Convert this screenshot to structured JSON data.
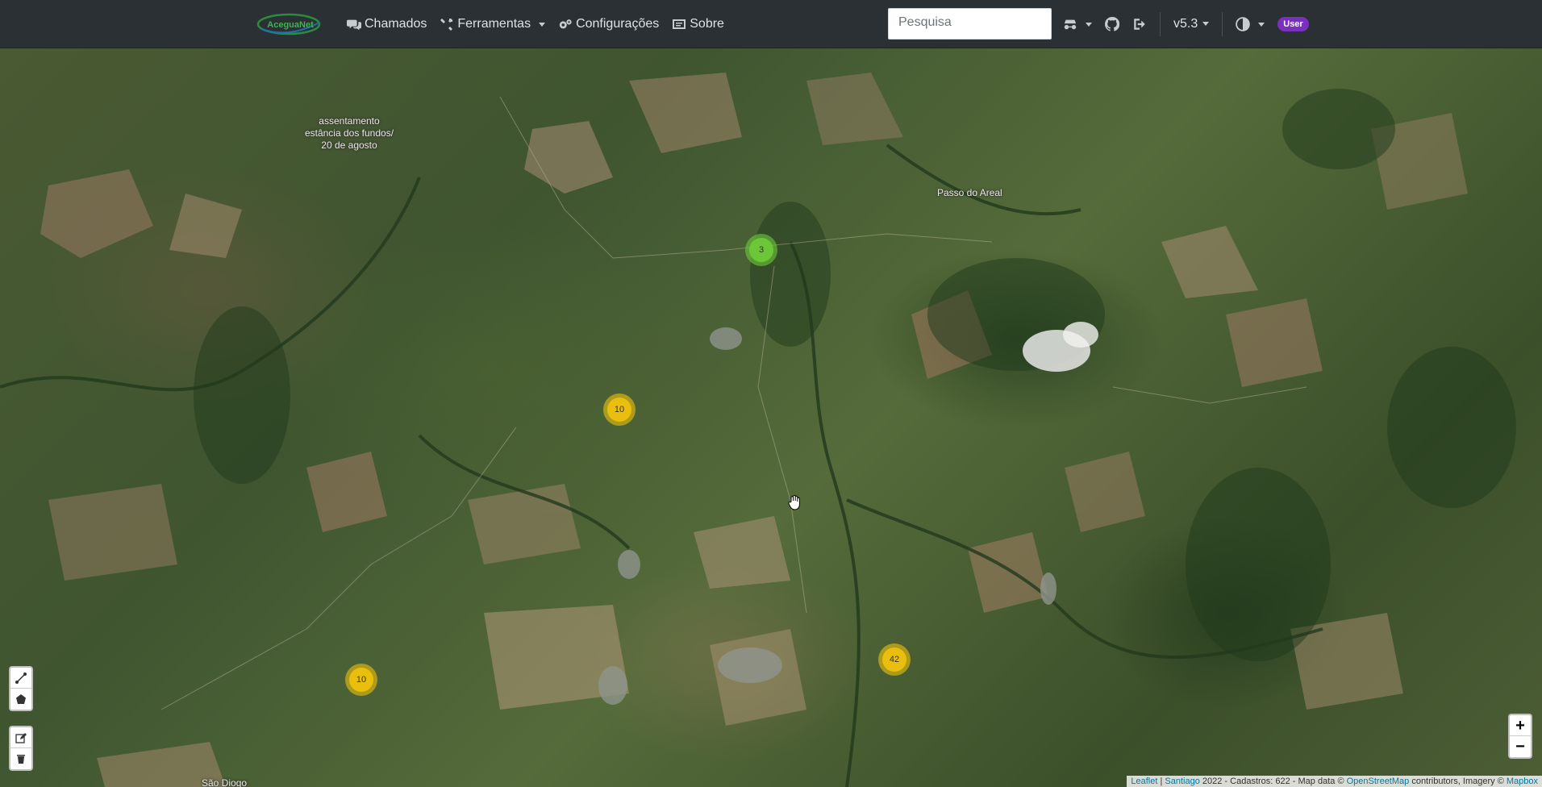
{
  "navbar": {
    "brand": "AceguaNet",
    "items": [
      {
        "label": "Chamados",
        "icon": "comments-icon"
      },
      {
        "label": "Ferramentas",
        "icon": "tools-icon"
      },
      {
        "label": "Configurações",
        "icon": "gears-icon"
      },
      {
        "label": "Sobre",
        "icon": "id-card-icon"
      }
    ],
    "search_placeholder": "Pesquisa",
    "version": "v5.3",
    "user_badge": "User"
  },
  "map": {
    "labels": [
      {
        "text": "assentamento\nestância dos fundos/\n20 de agosto"
      },
      {
        "text": "Passo do Areal"
      },
      {
        "text": "São Diogo"
      }
    ],
    "clusters": [
      {
        "count": "3",
        "level": "small"
      },
      {
        "count": "10",
        "level": "medium"
      },
      {
        "count": "10",
        "level": "medium"
      },
      {
        "count": "42",
        "level": "medium"
      }
    ],
    "zoom_in": "+",
    "zoom_out": "−",
    "attribution": {
      "leaflet": "Leaflet",
      "sep": " | ",
      "author": "Santiago",
      "text": " 2022 - Cadastros: 622 - Map data © ",
      "osm": "OpenStreetMap",
      "text2": " contributors, Imagery © ",
      "mapbox": "Mapbox"
    }
  },
  "colors": {
    "navbar_bg": "#2b3035",
    "badge_bg": "#7b2fbe",
    "cluster_small": "#6ecc39",
    "cluster_medium": "#f0c20c",
    "link": "#0078a8"
  }
}
